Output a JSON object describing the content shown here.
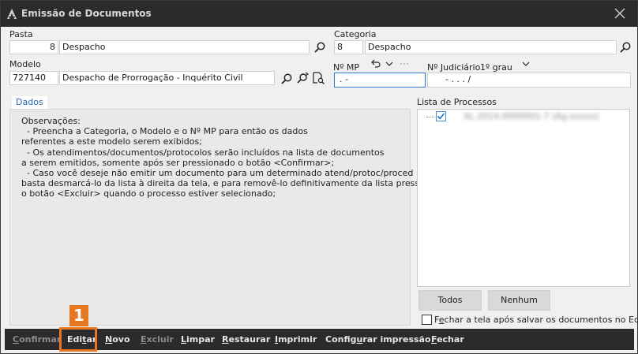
{
  "window": {
    "title": "Emissão de Documentos"
  },
  "pasta": {
    "label": "Pasta",
    "code": "8",
    "name": "Despacho"
  },
  "categoria": {
    "label": "Categoria",
    "code": "8",
    "name": "Despacho"
  },
  "modelo": {
    "label": "Modelo",
    "code": "727140",
    "name": "Despacho de Prorrogação - Inquérito Civil"
  },
  "mp": {
    "label": "Nº MP",
    "value": ".        -"
  },
  "judiciario": {
    "label": "Nº Judiciário",
    "grau": "1º grau",
    "value": "-      .      .    .     /"
  },
  "tabs": {
    "dados": "Dados"
  },
  "observacoes": "Observações:\n  - Preencha a Categoria, o Modelo e o Nº MP para então os dados\nreferentes a este modelo serem exibidos;\n  - Os atendimentos/documentos/protocolos serão incluídos na lista de documentos\na serem emitidos, somente após ser pressionado o botão <Confirmar>;\n  - Caso você deseje não emitir um documento para um determinado atend/protoc/proced\nbasta desmarcá-lo da lista à direita da tela, e para removê-lo definitivamente da lista pressione\no botão <Excluir> quando o processo estiver selecionado;",
  "lista": {
    "label": "Lista de Processos",
    "item": "XL.2014.0000001-7 (Ag.xxxxx)"
  },
  "buttons": {
    "todos": "Todos",
    "nenhum": "Nenhum"
  },
  "fechar_checkbox": {
    "pre": "F",
    "ul": "e",
    "post": "char a tela após salvar os documentos no Editor"
  },
  "footer": {
    "confirmar": {
      "pre": "",
      "ul": "C",
      "post": "onfirmar"
    },
    "editar": {
      "pre": "Edi",
      "ul": "t",
      "post": "ar"
    },
    "novo": {
      "pre": "",
      "ul": "N",
      "post": "ovo"
    },
    "excluir": {
      "pre": "",
      "ul": "E",
      "post": "xcluir"
    },
    "limpar": {
      "pre": "",
      "ul": "L",
      "post": "impar"
    },
    "restaurar": {
      "pre": "",
      "ul": "R",
      "post": "estaurar"
    },
    "imprimir": {
      "pre": "",
      "ul": "I",
      "post": "mprimir"
    },
    "config": {
      "pre": "Config",
      "ul": "u",
      "post": "rar impressão"
    },
    "fechar": {
      "pre": "",
      "ul": "F",
      "post": "echar"
    }
  },
  "annotation": {
    "step": "1"
  },
  "colors": {
    "accent": "#e8781f",
    "link": "#2468b4",
    "titlebar": "#2b2b2b"
  }
}
